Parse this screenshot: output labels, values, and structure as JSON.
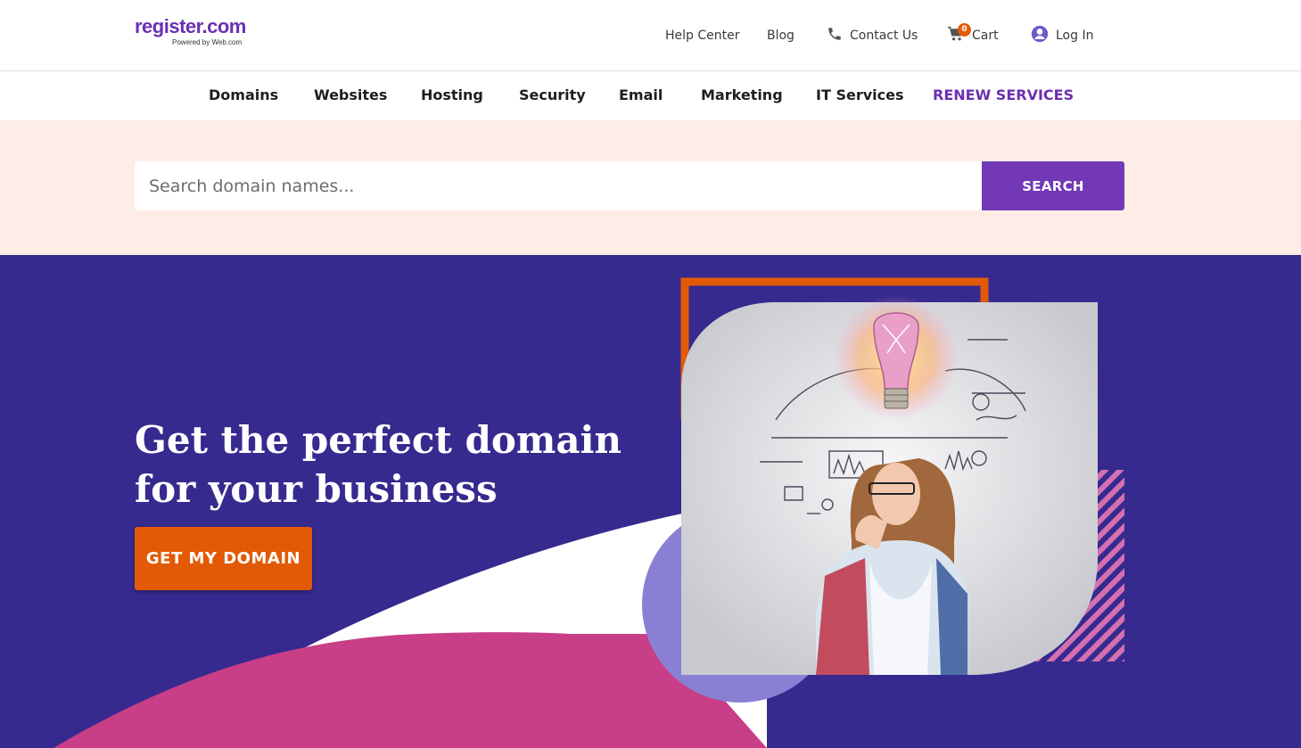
{
  "brand": {
    "name": "register.com",
    "tagline": "Powered by Web.com"
  },
  "utility_nav": {
    "help_center": "Help Center",
    "blog": "Blog",
    "contact_us": "Contact Us",
    "cart": "Cart",
    "cart_count": "0",
    "log_in": "Log In"
  },
  "main_nav": {
    "items": [
      {
        "label": "Domains"
      },
      {
        "label": "Websites"
      },
      {
        "label": "Hosting"
      },
      {
        "label": "Security"
      },
      {
        "label": "Email"
      },
      {
        "label": "Marketing"
      },
      {
        "label": "IT Services"
      },
      {
        "label": "RENEW SERVICES"
      }
    ]
  },
  "search": {
    "placeholder": "Search domain names...",
    "button_label": "SEARCH"
  },
  "hero": {
    "title_line1": "Get the perfect domain",
    "title_line2": "for your business",
    "cta_label": "GET MY DOMAIN"
  },
  "colors": {
    "brand_purple": "#6b2fb0",
    "search_button": "#7238b5",
    "hero_background": "#362a8f",
    "cta_orange": "#e25a06",
    "search_band": "#fdede6",
    "accent_pink": "#c83f87",
    "accent_lavender": "#8a80d3"
  },
  "icons": {
    "contact": "phone-icon",
    "cart": "cart-icon",
    "login": "user-circle-icon"
  }
}
